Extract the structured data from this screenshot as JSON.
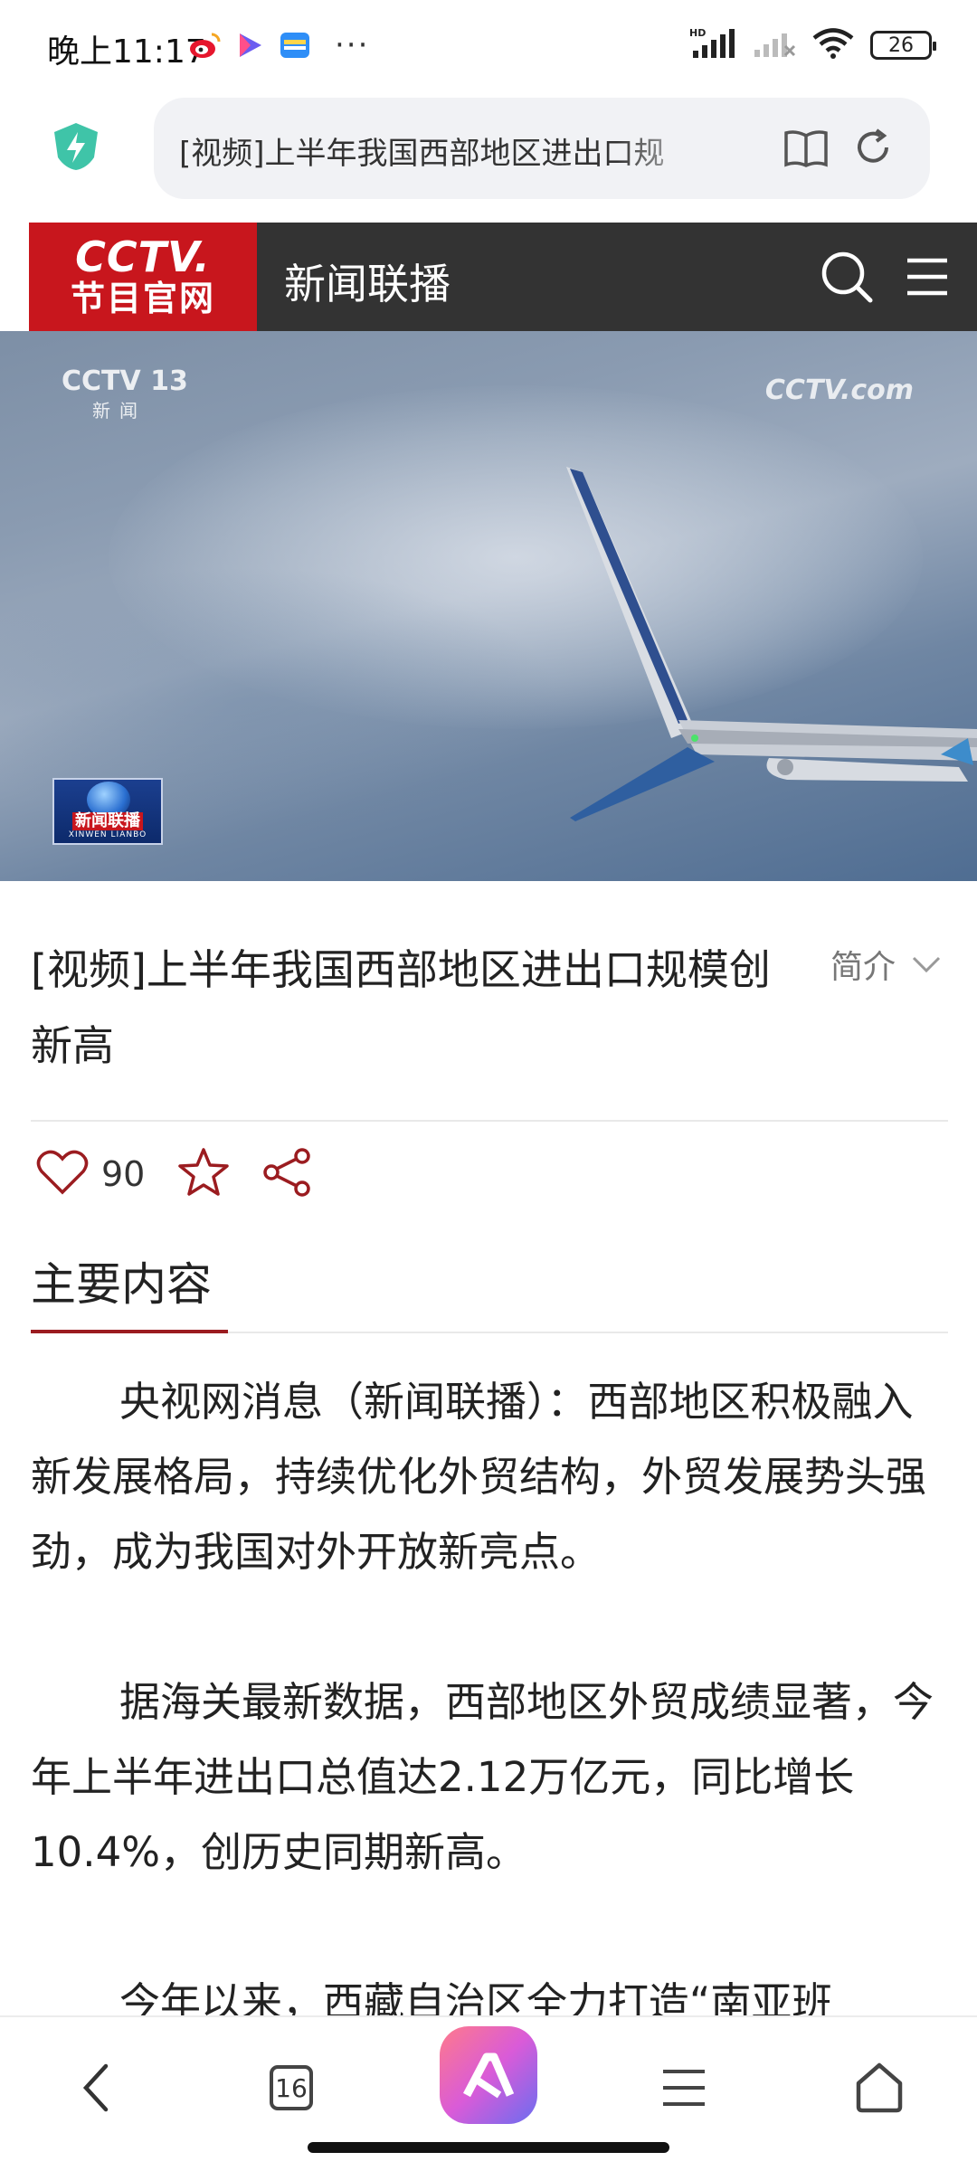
{
  "status_bar": {
    "time": "晚上11:17",
    "more": "···",
    "network_label": "HD",
    "battery": "26"
  },
  "browser": {
    "address_text": "[视频]上半年我国西部地区进出口规",
    "accent_shield": "#3fc4a8"
  },
  "site_header": {
    "logo_top": "CCTV.",
    "logo_bottom": "节目官网",
    "title": "新闻联播",
    "brand_color": "#c8161d"
  },
  "video": {
    "channel_logo": "CCTV 13",
    "channel_sub": "新闻",
    "watermark": "CCTV.com",
    "program_badge": "新闻联播",
    "program_badge_sub": "XINWEN LIANBO"
  },
  "article": {
    "title": "[视频]上半年我国西部地区进出口规模创新高",
    "intro_label": "简介",
    "like_count": "90",
    "section_title": "主要内容",
    "paragraphs": [
      "央视网消息（新闻联播）：西部地区积极融入新发展格局，持续优化外贸结构，外贸发展势头强劲，成为我国对外开放新亮点。",
      "据海关最新数据，西部地区外贸成绩显著，今年上半年进出口总值达2.12万亿元，同比增长10.4%，创历史同期新高。",
      "今年以来，西藏自治区全力打造“南亚班"
    ]
  },
  "bottom_nav": {
    "tab_count": "16"
  }
}
